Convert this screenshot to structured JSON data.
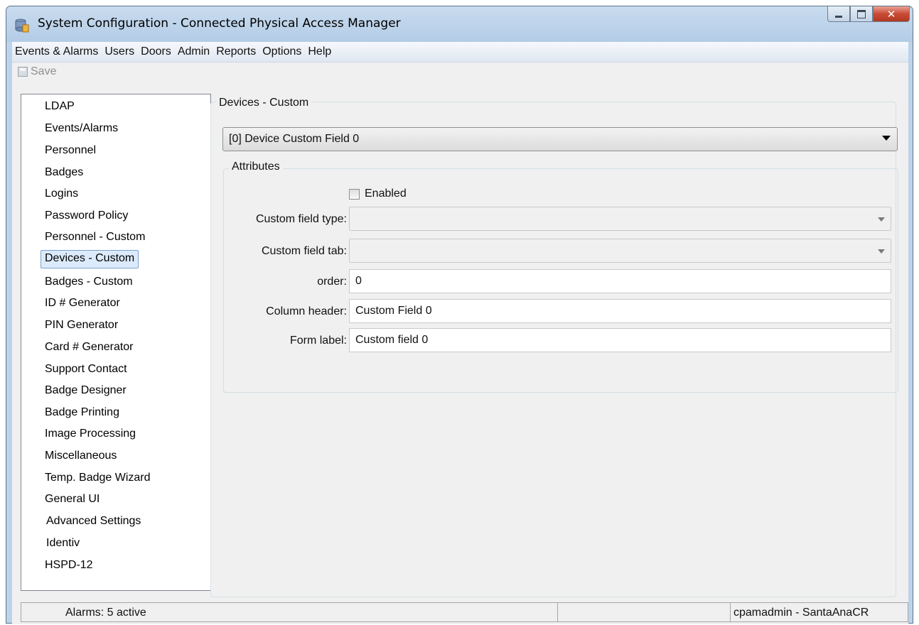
{
  "window": {
    "title": "System Configuration - Connected Physical Access Manager",
    "controls": {
      "minimize": "minimize-icon",
      "maximize": "maximize-icon",
      "close": "close-icon"
    }
  },
  "menubar": [
    "Events & Alarms",
    "Users",
    "Doors",
    "Admin",
    "Reports",
    "Options",
    "Help"
  ],
  "toolbar": {
    "save_label": "Save"
  },
  "nav": {
    "items": [
      "LDAP",
      "Events/Alarms",
      "Personnel",
      "Badges",
      "Logins",
      "Password Policy",
      "Personnel - Custom",
      "Devices - Custom",
      "Badges - Custom",
      "ID # Generator",
      "PIN Generator",
      "Card # Generator",
      "Support Contact",
      "Badge Designer",
      "Badge Printing",
      "Image Processing",
      "Miscellaneous",
      "Temp. Badge Wizard",
      "General UI",
      "Advanced Settings",
      "Identiv",
      "HSPD-12"
    ],
    "selected": "Devices - Custom"
  },
  "panel": {
    "title": "Devices - Custom",
    "field_select": "[0] Device Custom Field 0",
    "attributes": {
      "title": "Attributes",
      "enabled_label": "Enabled",
      "enabled_checked": false,
      "type_label": "Custom field type:",
      "type_value": "",
      "tab_label": "Custom field tab:",
      "tab_value": "",
      "order_label": "order:",
      "order_value": "0",
      "column_header_label": "Column header:",
      "column_header_value": "Custom Field 0",
      "form_label_label": "Form label:",
      "form_label_value": "Custom field 0"
    }
  },
  "statusbar": {
    "alarms": "Alarms: 5 active",
    "middle": "",
    "user": "cpamadmin - SantaAnaCR"
  }
}
